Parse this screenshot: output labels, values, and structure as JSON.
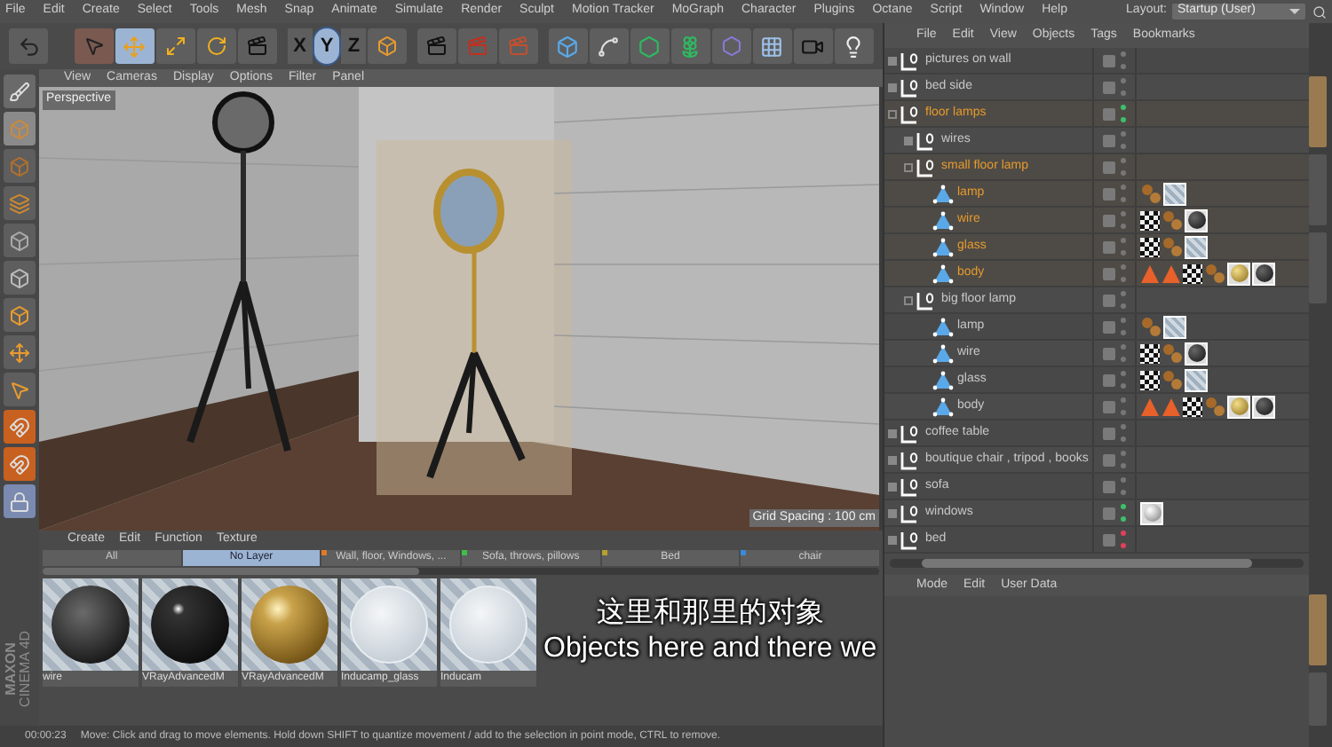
{
  "menu_bar": {
    "items": [
      "File",
      "Edit",
      "Create",
      "Select",
      "Tools",
      "Mesh",
      "Snap",
      "Animate",
      "Simulate",
      "Render",
      "Sculpt",
      "Motion Tracker",
      "MoGraph",
      "Character",
      "Plugins",
      "Octane",
      "Script",
      "Window",
      "Help"
    ],
    "layout_label": "Layout:",
    "layout_value": "Startup (User)"
  },
  "toolbar": {
    "axis_buttons": [
      {
        "label": "X",
        "selected": false
      },
      {
        "label": "Y",
        "selected": true
      },
      {
        "label": "Z",
        "selected": false
      }
    ]
  },
  "viewport": {
    "menu": [
      "View",
      "Cameras",
      "Display",
      "Options",
      "Filter",
      "Panel"
    ],
    "camera_label": "Perspective",
    "grid_spacing": "Grid Spacing : 100 cm"
  },
  "material_manager": {
    "menu": [
      "Create",
      "Edit",
      "Function",
      "Texture"
    ],
    "layers": [
      {
        "label": "All",
        "selected": false
      },
      {
        "label": "No Layer",
        "selected": true
      },
      {
        "label": "Wall, floor, Windows, ...",
        "selected": false,
        "color": "#e07a2a"
      },
      {
        "label": "Sofa, throws, pillows",
        "selected": false,
        "color": "#3fbf4a"
      },
      {
        "label": "Bed",
        "selected": false,
        "color": "#b8a030"
      },
      {
        "label": "chair",
        "selected": false,
        "color": "#3a8ad8"
      }
    ],
    "materials": [
      {
        "name": "wire",
        "kind": "matte"
      },
      {
        "name": "VRayAdvancedM",
        "kind": "glossy"
      },
      {
        "name": "VRayAdvancedM",
        "kind": "gold"
      },
      {
        "name": "Inducamp_glass",
        "kind": "glass"
      },
      {
        "name": "Inducam",
        "kind": "glass"
      }
    ]
  },
  "logo_lines": [
    "MAXON",
    "CINEMA 4D"
  ],
  "status_bar": {
    "time": "00:00:23",
    "message": "Move: Click and drag to move elements. Hold down SHIFT to quantize movement / add to the selection in point mode, CTRL to remove."
  },
  "object_manager": {
    "menu": [
      "File",
      "Edit",
      "View",
      "Objects",
      "Tags",
      "Bookmarks"
    ],
    "objects": [
      {
        "name": "pictures on wall",
        "kind": "null",
        "selected": false,
        "expanded": false
      },
      {
        "name": "bed side",
        "kind": "null",
        "selected": false,
        "expanded": false
      },
      {
        "name": "floor lamps",
        "kind": "null",
        "selected": true,
        "expanded": true,
        "color": "#3fbf6a",
        "children": [
          {
            "name": "wires",
            "kind": "null",
            "selected": false,
            "expanded": false
          },
          {
            "name": "small floor lamp",
            "kind": "null",
            "selected": true,
            "expanded": true,
            "children": [
              {
                "name": "lamp",
                "kind": "mesh",
                "selected": true,
                "tags": [
                  {
                    "kind": "dots"
                  },
                  {
                    "kind": "glass"
                  }
                ]
              },
              {
                "name": "wire",
                "kind": "mesh",
                "selected": true,
                "tags": [
                  {
                    "kind": "checker"
                  },
                  {
                    "kind": "dots"
                  },
                  {
                    "kind": "black"
                  }
                ]
              },
              {
                "name": "glass",
                "kind": "mesh",
                "selected": true,
                "tags": [
                  {
                    "kind": "checker"
                  },
                  {
                    "kind": "dots"
                  },
                  {
                    "kind": "glass"
                  }
                ]
              },
              {
                "name": "body",
                "kind": "mesh",
                "selected": true,
                "tags": [
                  {
                    "kind": "cone"
                  },
                  {
                    "kind": "cone"
                  },
                  {
                    "kind": "checker"
                  },
                  {
                    "kind": "dots"
                  },
                  {
                    "kind": "gold"
                  },
                  {
                    "kind": "black"
                  }
                ]
              }
            ]
          },
          {
            "name": "big floor lamp",
            "kind": "null",
            "selected": false,
            "expanded": true,
            "children": [
              {
                "name": "lamp",
                "kind": "mesh",
                "selected": false,
                "tags": [
                  {
                    "kind": "dots"
                  },
                  {
                    "kind": "glass"
                  }
                ]
              },
              {
                "name": "wire",
                "kind": "mesh",
                "selected": false,
                "tags": [
                  {
                    "kind": "checker"
                  },
                  {
                    "kind": "dots"
                  },
                  {
                    "kind": "black"
                  }
                ]
              },
              {
                "name": "glass",
                "kind": "mesh",
                "selected": false,
                "tags": [
                  {
                    "kind": "checker"
                  },
                  {
                    "kind": "dots"
                  },
                  {
                    "kind": "glass"
                  }
                ]
              },
              {
                "name": "body",
                "kind": "mesh",
                "selected": false,
                "tags": [
                  {
                    "kind": "cone"
                  },
                  {
                    "kind": "cone"
                  },
                  {
                    "kind": "checker"
                  },
                  {
                    "kind": "dots"
                  },
                  {
                    "kind": "gold"
                  },
                  {
                    "kind": "black"
                  }
                ]
              }
            ]
          }
        ]
      },
      {
        "name": "coffee table",
        "kind": "null",
        "selected": false,
        "expanded": false
      },
      {
        "name": "boutique chair , tripod , books",
        "kind": "null",
        "selected": false,
        "expanded": false
      },
      {
        "name": "sofa",
        "kind": "null",
        "selected": false,
        "expanded": false
      },
      {
        "name": "windows",
        "kind": "null",
        "selected": false,
        "expanded": false,
        "color": "#3fbf6a",
        "tags": [
          {
            "kind": "white"
          }
        ]
      },
      {
        "name": "bed",
        "kind": "null",
        "selected": false,
        "expanded": false,
        "color": "#e0405a"
      }
    ]
  },
  "attribute_manager": {
    "menu": [
      "Mode",
      "Edit",
      "User Data"
    ]
  },
  "subtitles": [
    "这里和那里的对象",
    "Objects here and there we"
  ]
}
